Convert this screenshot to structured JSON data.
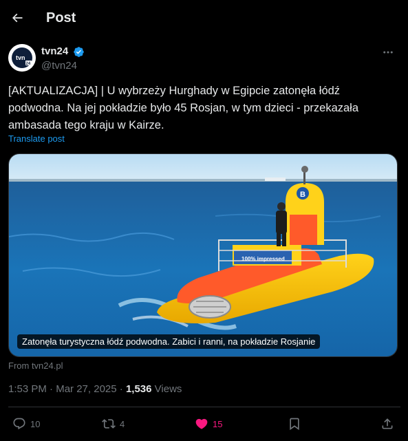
{
  "header": {
    "title": "Post",
    "back_icon": "arrow-left-icon"
  },
  "author": {
    "display_name": "tvn24",
    "handle": "@tvn24",
    "avatar_text": "tvn",
    "avatar_badge": "24",
    "verified_color": "#1d9bf0"
  },
  "post": {
    "text": "[AKTUALIZACJA] | U wybrzeży Hurghady w Egipcie zatonęła łódź podwodna. Na jej pokładzie było 45 Rosjan, w tym dzieci - przekazała ambasada tego kraju w Kairze.",
    "translate_label": "Translate post",
    "media_caption": "Zatonęła turystyczna łódź podwodna. Zabici i ranni, na pokładzie Rosjanie",
    "media_banner_text": "100% impressed",
    "media_badge_letter": "B",
    "source": "From tvn24.pl"
  },
  "meta": {
    "time": "1:53 PM",
    "separator": "·",
    "date": "Mar 27, 2025",
    "views_count": "1,536",
    "views_label": "Views"
  },
  "actions": {
    "replies": "10",
    "reposts": "4",
    "likes": "15",
    "bookmark_icon": "bookmark-icon",
    "share_icon": "share-icon"
  },
  "colors": {
    "background": "#000000",
    "text": "#e7e9ea",
    "muted": "#71767b",
    "accent": "#1d9bf0",
    "like": "#f91880",
    "border": "#2f3336"
  }
}
